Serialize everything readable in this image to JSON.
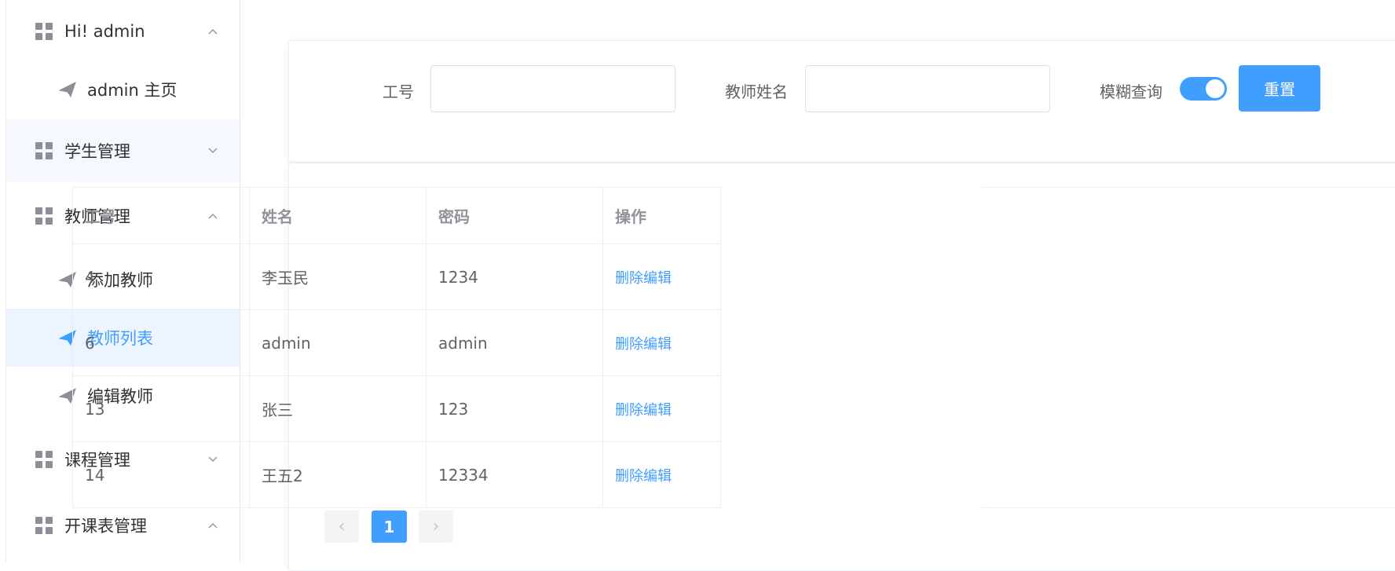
{
  "sidebar": {
    "items": [
      {
        "type": "group",
        "label": "Hi! admin",
        "expanded": true
      },
      {
        "type": "sub",
        "label": "admin 主页"
      },
      {
        "type": "group",
        "label": "学生管理",
        "expanded": false
      },
      {
        "type": "group",
        "label": "教师管理",
        "expanded": true
      },
      {
        "type": "sub",
        "label": "添加教师"
      },
      {
        "type": "sub",
        "label": "教师列表",
        "active": true
      },
      {
        "type": "sub",
        "label": "编辑教师"
      },
      {
        "type": "group",
        "label": "课程管理",
        "expanded": false
      },
      {
        "type": "group",
        "label": "开课表管理",
        "expanded": true
      }
    ]
  },
  "search": {
    "id_label": "工号",
    "id_value": "",
    "name_label": "教师姓名",
    "name_value": "",
    "fuzzy_label": "模糊查询",
    "fuzzy_on": true,
    "reset_label": "重置"
  },
  "table": {
    "columns": [
      "工号",
      "姓名",
      "密码",
      "操作"
    ],
    "rows": [
      {
        "id": "4",
        "name": "李玉民",
        "password": "1234",
        "op": "删除编辑"
      },
      {
        "id": "6",
        "name": "admin",
        "password": "admin",
        "op": "删除编辑"
      },
      {
        "id": "13",
        "name": "张三",
        "password": "123",
        "op": "删除编辑"
      },
      {
        "id": "14",
        "name": "王五2",
        "password": "12334",
        "op": "删除编辑"
      }
    ]
  },
  "pagination": {
    "prev_icon": "‹",
    "current_page": "1",
    "next_icon": "›"
  },
  "colors": {
    "accent": "#409eff",
    "active_bg": "#ecf5ff",
    "hover_bg": "#f5f8fe"
  }
}
